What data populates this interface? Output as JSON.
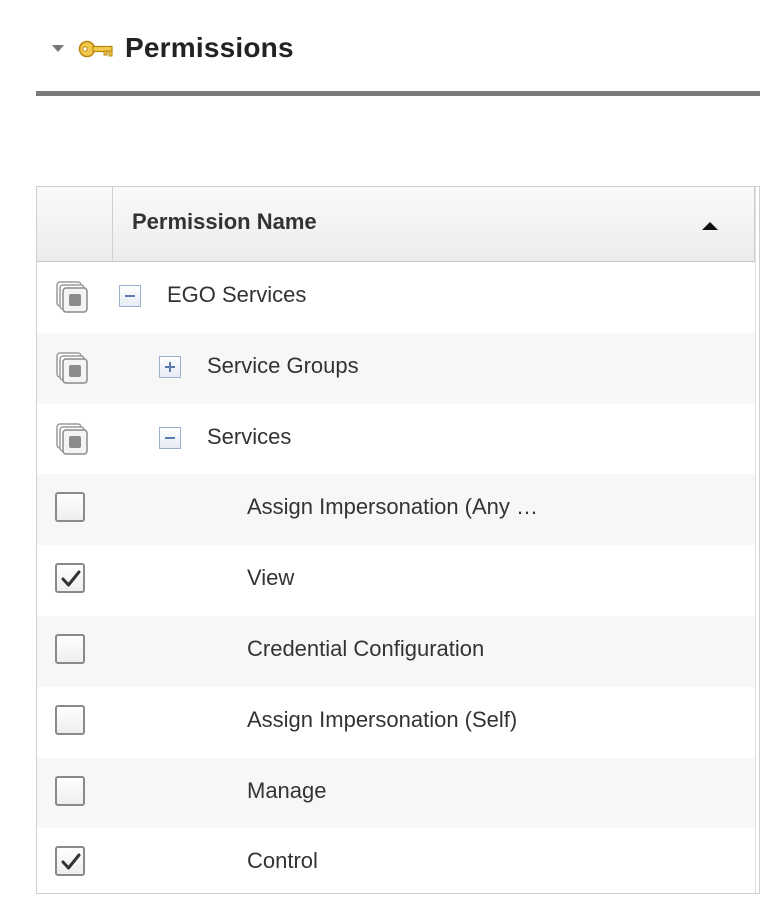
{
  "section": {
    "title": "Permissions",
    "icon": "key-icon",
    "accent_color": "#e8b923"
  },
  "grid": {
    "column_header": "Permission Name",
    "sort": "ascending",
    "rows": [
      {
        "label": "EGO Services",
        "level": 0,
        "kind": "group",
        "expander": "collapse"
      },
      {
        "label": "Service Groups",
        "level": 1,
        "kind": "group",
        "expander": "expand"
      },
      {
        "label": "Services",
        "level": 1,
        "kind": "group",
        "expander": "collapse"
      },
      {
        "label": "Assign Impersonation (Any …",
        "level": 2,
        "kind": "leaf",
        "checked": false
      },
      {
        "label": "View",
        "level": 2,
        "kind": "leaf",
        "checked": true
      },
      {
        "label": "Credential Configuration",
        "level": 2,
        "kind": "leaf",
        "checked": false
      },
      {
        "label": "Assign Impersonation (Self)",
        "level": 2,
        "kind": "leaf",
        "checked": false
      },
      {
        "label": "Manage",
        "level": 2,
        "kind": "leaf",
        "checked": false
      },
      {
        "label": "Control",
        "level": 2,
        "kind": "leaf",
        "checked": true
      }
    ]
  }
}
